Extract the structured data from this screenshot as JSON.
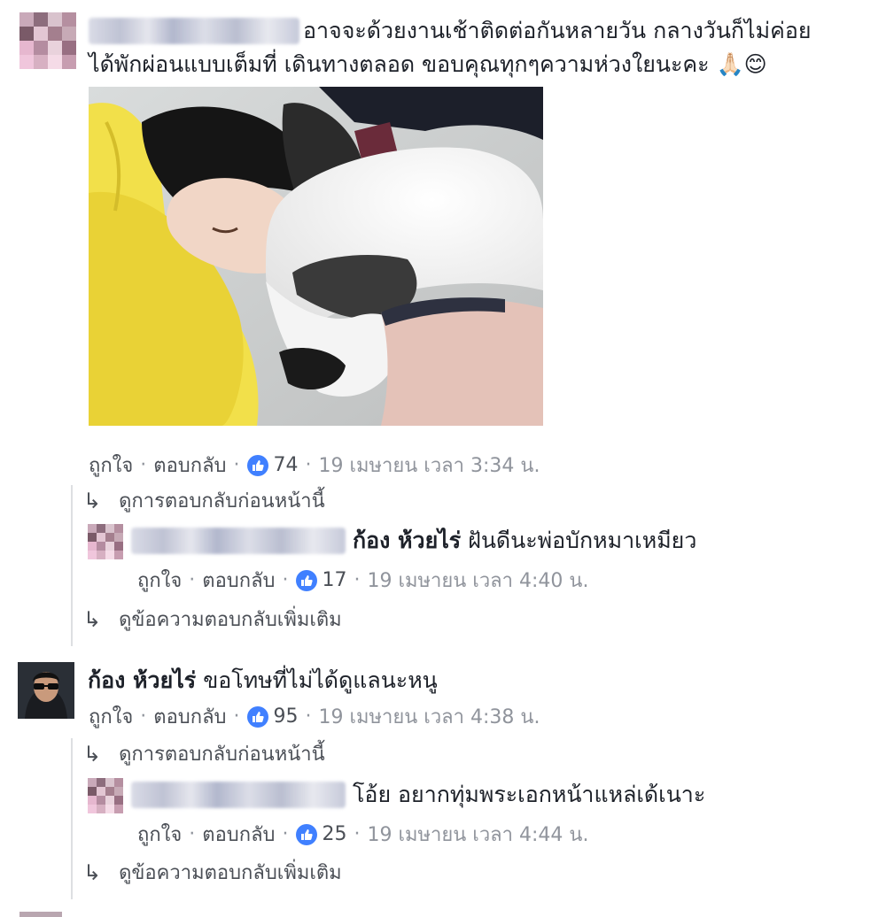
{
  "comment1": {
    "text_line1": "อาจจะด้วยงานเช้าติดต่อกันหลายวัน กลางวันก็ไม่ค่อย",
    "text_line2": "ได้พักผ่อนแบบเต็มที่ เดินทางตลอด ขอบคุณทุกๆความห่วงใยนะคะ 🙏🏻😊",
    "like": "ถูกใจ",
    "reply": "ตอบกลับ",
    "likes": "74",
    "time": "19 เมษายน เวลา 3:34 น.",
    "previous_replies": "ดูการตอบกลับก่อนหน้านี้",
    "reply1": {
      "tag": "ก้อง ห้วยไร่",
      "text": "ฝันดีนะพ่อบักหมาเหมียว",
      "like": "ถูกใจ",
      "reply": "ตอบกลับ",
      "likes": "17",
      "time": "19 เมษายน เวลา 4:40 น."
    },
    "more_replies": "ดูข้อความตอบกลับเพิ่มเติม"
  },
  "comment2": {
    "author": "ก้อง ห้วยไร่",
    "text": "ขอโทษที่ไม่ได้ดูแลนะหนู",
    "like": "ถูกใจ",
    "reply": "ตอบกลับ",
    "likes": "95",
    "time": "19 เมษายน เวลา 4:38 น.",
    "previous_replies": "ดูการตอบกลับก่อนหน้านี้",
    "reply1": {
      "text": "โอ้ย อยากทุ่มพระเอกหน้าแหล่เด้เนาะ",
      "like": "ถูกใจ",
      "reply": "ตอบกลับ",
      "likes": "25",
      "time": "19 เมษายน เวลา 4:44 น."
    },
    "more_replies": "ดูข้อความตอบกลับเพิ่มเติม"
  },
  "colors": {
    "like_blue": "#4080ff",
    "meta_gray": "#90949c",
    "link_gray": "#4b4f56"
  }
}
